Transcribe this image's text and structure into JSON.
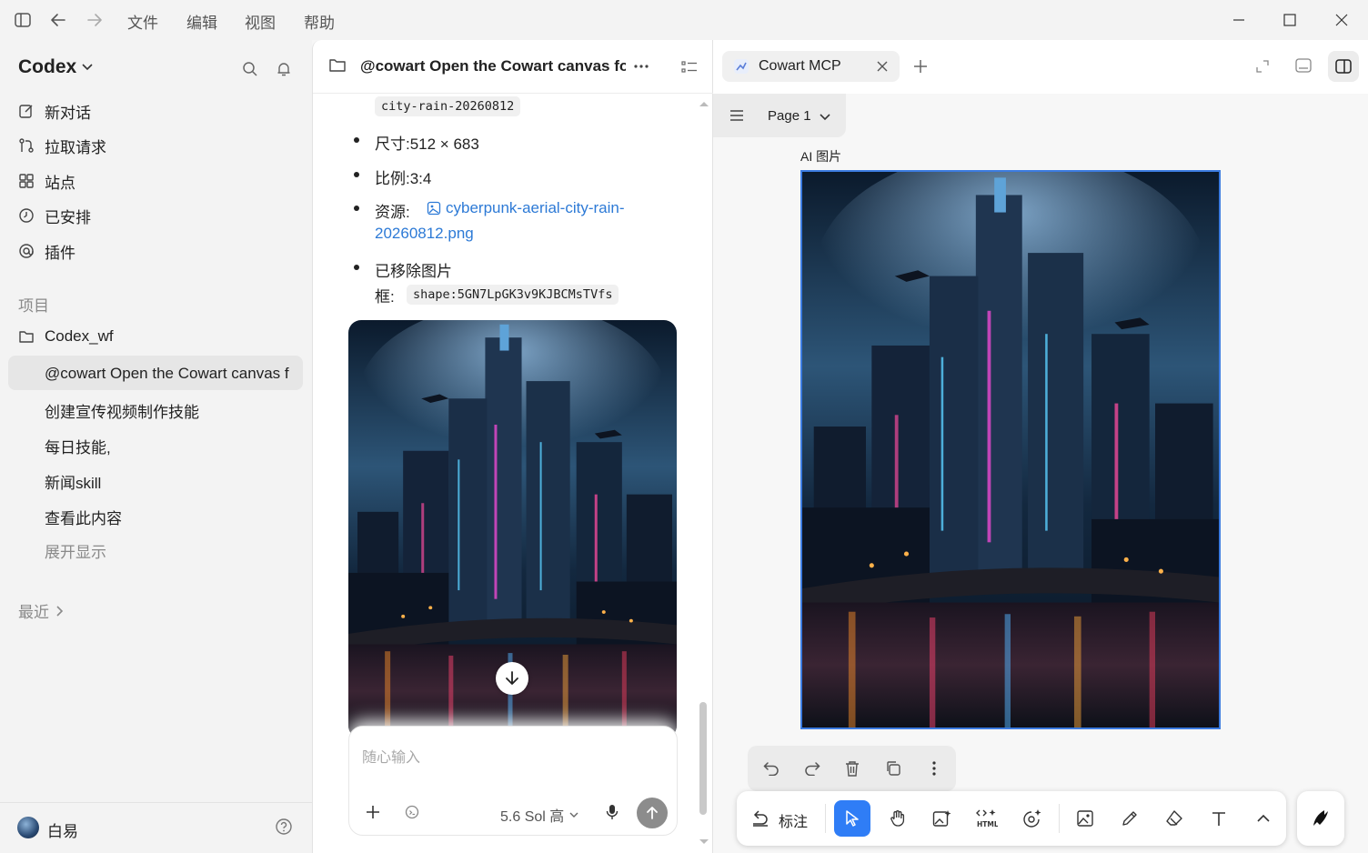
{
  "menu": {
    "file": "文件",
    "edit": "编辑",
    "view": "视图",
    "help": "帮助"
  },
  "sidebar": {
    "brand": "Codex",
    "nav": [
      {
        "label": "新对话",
        "icon": "new-chat-icon"
      },
      {
        "label": "拉取请求",
        "icon": "pull-request-icon"
      },
      {
        "label": "站点",
        "icon": "sites-icon"
      },
      {
        "label": "已安排",
        "icon": "clock-icon"
      },
      {
        "label": "插件",
        "icon": "plugin-icon"
      }
    ],
    "projects_label": "项目",
    "project_folder": "Codex_wf",
    "threads": [
      "@cowart Open the Cowart canvas f",
      "创建宣传视频制作技能",
      "每日技能,",
      "新闻skill",
      "查看此内容"
    ],
    "show_more": "展开显示",
    "recent_label": "最近",
    "user_name": "白易"
  },
  "chat": {
    "title": "@cowart Open the Cowart canvas fo",
    "code_name": "city-rain-20260812",
    "size_line": "尺寸:512 × 683",
    "ratio_line": "比例:3:4",
    "resource_prefix": "资源:",
    "resource_link_1": "cyberpunk-aerial-city-rain-",
    "resource_link_2": "20260812.png",
    "removed_line_1": "已移除图片",
    "removed_line_2": "框:",
    "shape_id": "shape:5GN7LpGK3v9KJBCMsTVfs",
    "composer_placeholder": "随心输入",
    "model": "5.6 Sol 高"
  },
  "canvas": {
    "tab_label": "Cowart MCP",
    "page": "Page 1",
    "frame_label": "AI 图片",
    "annotate": "标注"
  }
}
